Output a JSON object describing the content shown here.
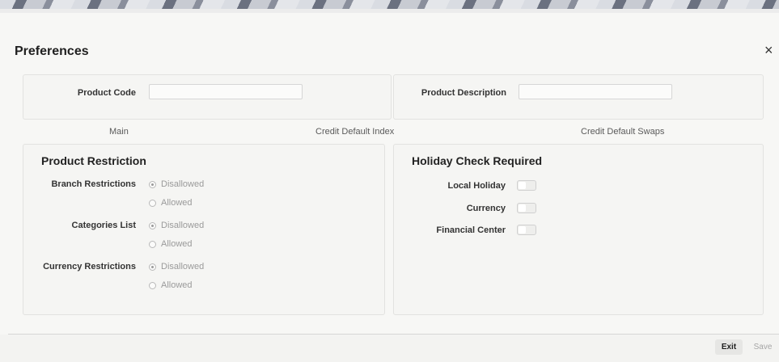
{
  "window": {
    "title": "Preferences",
    "close_icon": "×"
  },
  "product": {
    "code_label": "Product Code",
    "code_value": "",
    "description_label": "Product Description",
    "description_value": ""
  },
  "tabs": [
    {
      "label": "Main"
    },
    {
      "label": "Credit Default Index"
    },
    {
      "label": "Credit Default Swaps"
    }
  ],
  "product_restriction": {
    "title": "Product Restriction",
    "groups": [
      {
        "label": "Branch Restrictions",
        "options": [
          "Disallowed",
          "Allowed"
        ],
        "selected": "Disallowed"
      },
      {
        "label": "Categories List",
        "options": [
          "Disallowed",
          "Allowed"
        ],
        "selected": "Disallowed"
      },
      {
        "label": "Currency Restrictions",
        "options": [
          "Disallowed",
          "Allowed"
        ],
        "selected": "Disallowed"
      }
    ]
  },
  "holiday_check": {
    "title": "Holiday Check Required",
    "toggles": [
      {
        "label": "Local Holiday",
        "on": false
      },
      {
        "label": "Currency",
        "on": false
      },
      {
        "label": "Financial Center",
        "on": false
      }
    ]
  },
  "footer": {
    "exit_label": "Exit",
    "save_label": "Save"
  }
}
